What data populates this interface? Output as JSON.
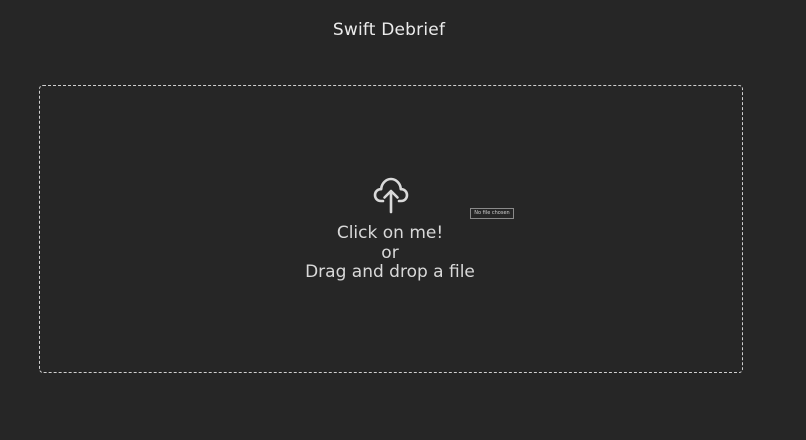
{
  "app": {
    "title": "Swift Debrief"
  },
  "upload": {
    "prompt_line1": "Click on me!",
    "prompt_line2": "or",
    "prompt_line3": "Drag and drop a file",
    "file_status": "No file chosen",
    "icon": "cloud-upload-icon"
  },
  "colors": {
    "background": "#262626",
    "text": "#e6e6e6",
    "border": "#cfcfcf"
  }
}
